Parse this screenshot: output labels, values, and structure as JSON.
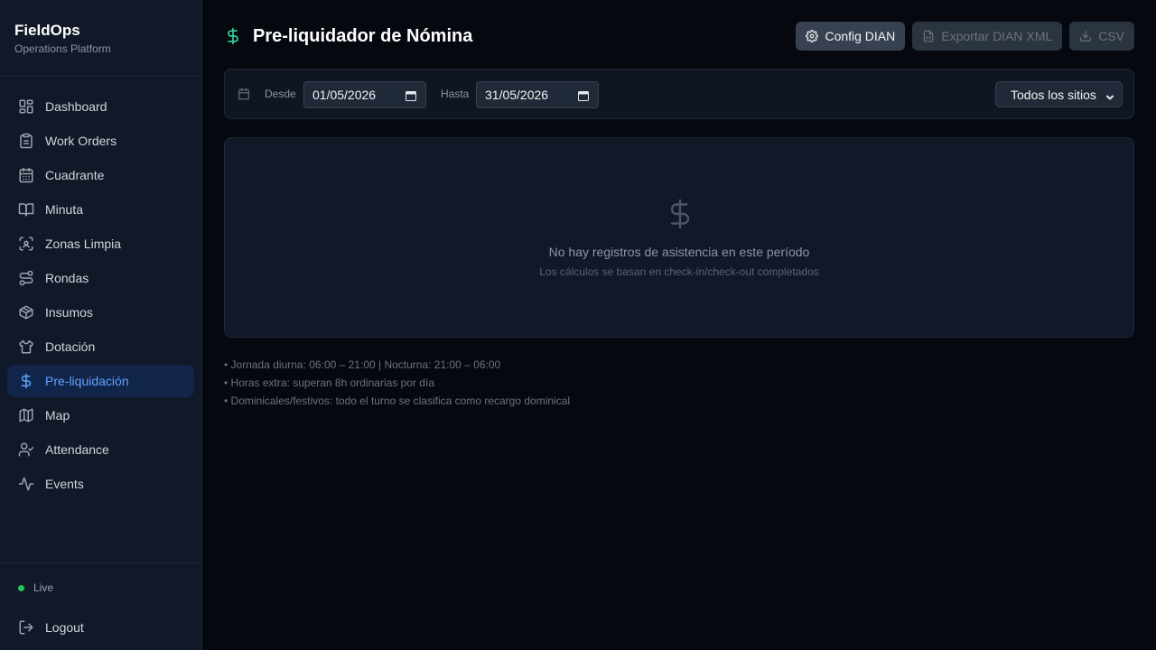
{
  "brand": {
    "title": "FieldOps",
    "subtitle": "Operations Platform"
  },
  "sidebar": {
    "items": [
      {
        "label": "Dashboard",
        "icon": "dashboard-icon"
      },
      {
        "label": "Work Orders",
        "icon": "clipboard-icon"
      },
      {
        "label": "Cuadrante",
        "icon": "calendar-grid-icon"
      },
      {
        "label": "Minuta",
        "icon": "book-icon"
      },
      {
        "label": "Zonas Limpia",
        "icon": "scan-icon"
      },
      {
        "label": "Rondas",
        "icon": "route-icon"
      },
      {
        "label": "Insumos",
        "icon": "package-icon"
      },
      {
        "label": "Dotación",
        "icon": "shirt-icon"
      },
      {
        "label": "Pre-liquidación",
        "icon": "dollar-icon",
        "active": true
      },
      {
        "label": "Map",
        "icon": "map-icon"
      },
      {
        "label": "Attendance",
        "icon": "user-check-icon"
      },
      {
        "label": "Events",
        "icon": "activity-icon"
      }
    ],
    "status": "Live",
    "logout": "Logout"
  },
  "header": {
    "title": "Pre-liquidador de Nómina",
    "buttons": {
      "config": "Config DIAN",
      "export": "Exportar DIAN XML",
      "csv": "CSV"
    }
  },
  "filters": {
    "from_label": "Desde",
    "from_value": "01/05/2026",
    "to_label": "Hasta",
    "to_value": "31/05/2026",
    "site_select": "Todos los sitios"
  },
  "empty_state": {
    "title": "No hay registros de asistencia en este período",
    "subtitle": "Los cálculos se basan en check-in/check-out completados"
  },
  "notes": [
    "• Jornada diurna: 06:00 – 21:00 | Nocturna: 21:00 – 06:00",
    "• Horas extra: superan 8h ordinarias por día",
    "• Dominicales/festivos: todo el turno se clasifica como recargo dominical"
  ],
  "colors": {
    "accent": "#60a5fa",
    "active_bg": "#11244a",
    "money_green": "#34d399",
    "live_green": "#22c55e"
  }
}
